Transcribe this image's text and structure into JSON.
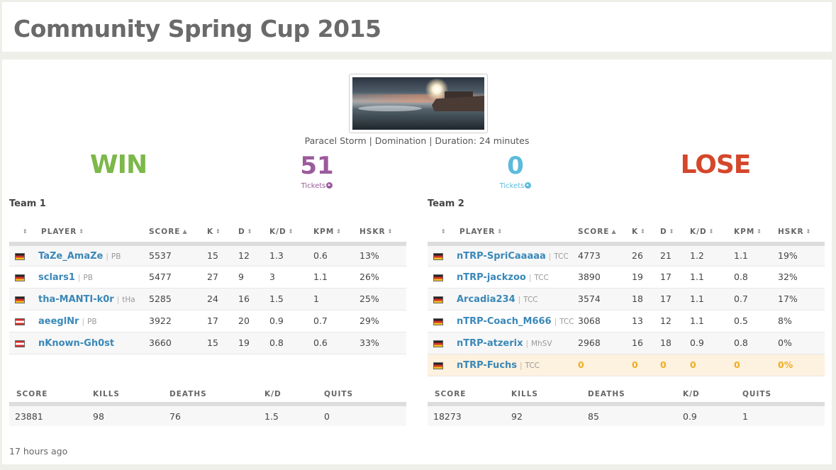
{
  "title": "Community Spring Cup 2015",
  "map_info": "Paracel Storm | Domination | Duration: 24 minutes",
  "result": {
    "team1": {
      "outcome": "WIN",
      "tickets": "51",
      "tickets_label": "Tickets",
      "color": "#7cb84a"
    },
    "team2": {
      "outcome": "LOSE",
      "tickets": "0",
      "tickets_label": "Tickets",
      "color": "#d4472b"
    }
  },
  "columns": {
    "player": "PLAYER",
    "score": "SCORE",
    "k": "K",
    "d": "D",
    "kd": "K/D",
    "kpm": "KPM",
    "hskr": "HSKR"
  },
  "summary_columns": {
    "score": "SCORE",
    "kills": "KILLS",
    "deaths": "DEATHS",
    "kd": "K/D",
    "quits": "QUITS"
  },
  "teams": [
    {
      "name": "Team 1",
      "players": [
        {
          "flag": "de",
          "name": "TaZe_AmaZe",
          "clan": "PB",
          "score": "5537",
          "k": "15",
          "d": "12",
          "kd": "1.3",
          "kpm": "0.6",
          "hskr": "13%"
        },
        {
          "flag": "de",
          "name": "sclars1",
          "clan": "PB",
          "score": "5477",
          "k": "27",
          "d": "9",
          "kd": "3",
          "kpm": "1.1",
          "hskr": "26%"
        },
        {
          "flag": "de",
          "name": "tha-MANTI-k0r",
          "clan": "tHa",
          "score": "5285",
          "k": "24",
          "d": "16",
          "kd": "1.5",
          "kpm": "1",
          "hskr": "25%"
        },
        {
          "flag": "at",
          "name": "aeeglNr",
          "clan": "PB",
          "score": "3922",
          "k": "17",
          "d": "20",
          "kd": "0.9",
          "kpm": "0.7",
          "hskr": "29%"
        },
        {
          "flag": "at",
          "name": "nKnown-Gh0st",
          "clan": "",
          "score": "3660",
          "k": "15",
          "d": "19",
          "kd": "0.8",
          "kpm": "0.6",
          "hskr": "33%"
        }
      ],
      "summary": {
        "score": "23881",
        "kills": "98",
        "deaths": "76",
        "kd": "1.5",
        "quits": "0"
      }
    },
    {
      "name": "Team 2",
      "players": [
        {
          "flag": "de",
          "name": "nTRP-SpriCaaaaa",
          "clan": "TCC",
          "score": "4773",
          "k": "26",
          "d": "21",
          "kd": "1.2",
          "kpm": "1.1",
          "hskr": "19%"
        },
        {
          "flag": "de",
          "name": "nTRP-jackzoo",
          "clan": "TCC",
          "score": "3890",
          "k": "19",
          "d": "17",
          "kd": "1.1",
          "kpm": "0.8",
          "hskr": "32%"
        },
        {
          "flag": "de",
          "name": "Arcadia234",
          "clan": "TCC",
          "score": "3574",
          "k": "18",
          "d": "17",
          "kd": "1.1",
          "kpm": "0.7",
          "hskr": "17%"
        },
        {
          "flag": "de",
          "name": "nTRP-Coach_M666",
          "clan": "TCC",
          "score": "3068",
          "k": "13",
          "d": "12",
          "kd": "1.1",
          "kpm": "0.5",
          "hskr": "8%"
        },
        {
          "flag": "de",
          "name": "nTRP-atzerix",
          "clan": "MhSV",
          "score": "2968",
          "k": "16",
          "d": "18",
          "kd": "0.9",
          "kpm": "0.8",
          "hskr": "0%"
        },
        {
          "flag": "de",
          "name": "nTRP-Fuchs",
          "clan": "TCC",
          "score": "0",
          "k": "0",
          "d": "0",
          "kd": "0",
          "kpm": "0",
          "hskr": "0%",
          "highlight": true
        }
      ],
      "summary": {
        "score": "18273",
        "kills": "92",
        "deaths": "85",
        "kd": "0.9",
        "quits": "1"
      }
    }
  ],
  "timestamp": "17 hours ago"
}
